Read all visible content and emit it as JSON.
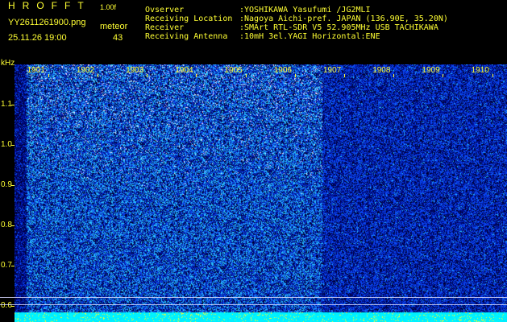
{
  "header": {
    "app_title": "HROFFT",
    "app_version": "1.00f",
    "file_name": "YY2611261900.png",
    "date_time": "25.11.26 19:00",
    "event_label": "meteor",
    "event_count": "43"
  },
  "station_info": [
    {
      "key": "Ovserver",
      "value": ":YOSHIKAWA Yasufumi /JG2MLI"
    },
    {
      "key": "Receiving Location",
      "value": ":Nagoya Aichi-pref. JAPAN (136.90E, 35.20N)"
    },
    {
      "key": "Receiver",
      "value": ":SMArt RTL-SDR V5 52.905MHz USB TACHIKAWA"
    },
    {
      "key": "Receiving Antenna",
      "value": ":10mH 3el.YAGI Horizontal:ENE"
    }
  ],
  "chart_data": {
    "type": "heatmap",
    "ylabel": "kHz",
    "yticks": [
      "1.1",
      "1.0",
      "0.9",
      "0.8",
      "0.7",
      "0.6"
    ],
    "ytick_values": [
      1.1,
      1.0,
      0.9,
      0.8,
      0.7,
      0.6
    ],
    "ylim": [
      0.56,
      1.2
    ],
    "xticks": [
      "1901",
      "1902",
      "1903",
      "1904",
      "1905",
      "1906",
      "1907",
      "1908",
      "1909",
      "1910"
    ],
    "xtick_values": [
      1,
      2,
      3,
      4,
      5,
      6,
      7,
      8,
      9,
      10
    ],
    "xlim": [
      0.32,
      10.3
    ],
    "reference_lines_khz": [
      0.623,
      0.605
    ],
    "grid": false,
    "colors": {
      "background_low": "#000033",
      "signal_mid": "#1a3cff",
      "signal_high": "#33ccff",
      "peak": "#ffffff",
      "labels": "#ffff33",
      "baseline": "#00ffff"
    }
  }
}
